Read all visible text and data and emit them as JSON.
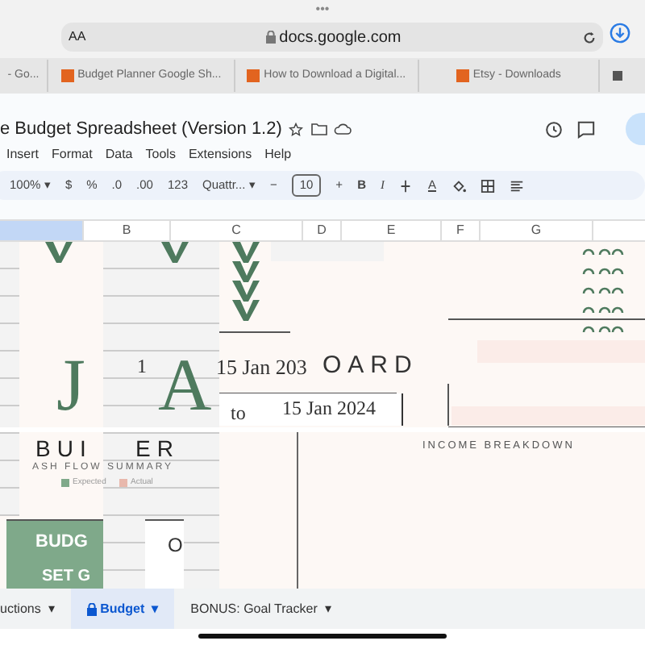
{
  "browser": {
    "menu_dots": "•••",
    "text_size": "AA",
    "url": "docs.google.com"
  },
  "tabs": [
    {
      "title": "- Go...",
      "kind": "plain",
      "selected": false
    },
    {
      "title": "Budget Planner Google Sh...",
      "kind": "etsy",
      "selected": false
    },
    {
      "title": "How to Download a Digital...",
      "kind": "etsy",
      "selected": false
    },
    {
      "title": "Etsy - Downloads",
      "kind": "etsy",
      "selected": false
    }
  ],
  "doc": {
    "title": "e Budget Spreadsheet (Version 1.2)",
    "menu": [
      "Insert",
      "Format",
      "Data",
      "Tools",
      "Extensions",
      "Help"
    ]
  },
  "toolbar": {
    "zoom": "100%",
    "zoom_caret": "▾",
    "font_caret": "▾",
    "number_formats": [
      "$",
      "%",
      ".0",
      ".00",
      "123"
    ],
    "font": "Quattr...",
    "font_size": "10",
    "minus": "−",
    "plus": "+",
    "bold": "B",
    "italic": "I",
    "text_color": "A"
  },
  "column_headers": [
    "B",
    "C",
    "D",
    "E",
    "F",
    "G"
  ],
  "sheet": {
    "big_letters": [
      "J",
      "A"
    ],
    "date_prefix": "1",
    "date_from": "15 Jan 203",
    "heading_fragment": "OARD",
    "to": "to",
    "date_to": "15 Jan 2024",
    "title_fragments": [
      "BUI",
      "ER"
    ],
    "cash_flow_title": "ASH FLOW SUMMARY",
    "legend": [
      {
        "label": "Expected",
        "color": "#7fa98a"
      },
      {
        "label": "Actual",
        "color": "#e8b8ac"
      }
    ],
    "income_title": "INCOME BREAKDOWN",
    "budget_label": "BUDG",
    "goal_label": "SET G",
    "value_fragment": "O"
  },
  "sheet_tabs": [
    {
      "label": "uctions",
      "caret": "▾",
      "selected": false,
      "locked": false
    },
    {
      "label": "Budget",
      "caret": "▾",
      "selected": true,
      "locked": true
    },
    {
      "label": "BONUS: Goal Tracker",
      "caret": "▾",
      "selected": false,
      "locked": false
    }
  ]
}
